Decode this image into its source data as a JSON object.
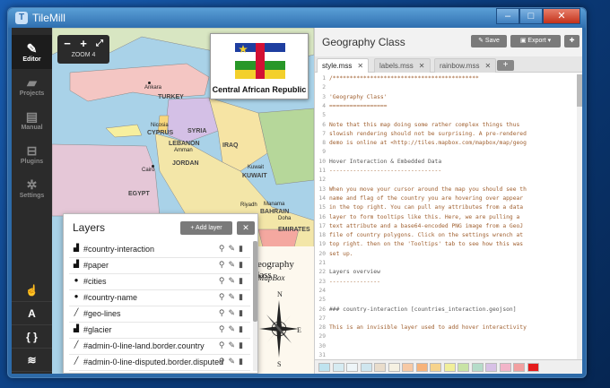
{
  "window": {
    "title": "TileMill"
  },
  "nav": {
    "items": [
      {
        "label": "Editor",
        "icon": "pencil-icon"
      },
      {
        "label": "Projects",
        "icon": "folder-icon"
      },
      {
        "label": "Manual",
        "icon": "book-icon"
      },
      {
        "label": "Plugins",
        "icon": "plug-icon"
      },
      {
        "label": "Settings",
        "icon": "gear-icon"
      }
    ]
  },
  "map": {
    "zoom_label": "ZOOM 4",
    "tooltip_country": "Central African Republic",
    "legend_title": "Geography Class",
    "legend_subtitle": "MapBox",
    "labels": {
      "ankara": "Ankara",
      "turkey": "TURKEY",
      "nicosia": "Nicosia",
      "syria": "SYRIA",
      "cyprus": "CYPRUS",
      "lebanon": "LEBANON",
      "iraq": "IRAQ",
      "amman": "Amman",
      "jordan": "JORDAN",
      "cairo": "Cairo",
      "kuwait_city": "Kuwait",
      "kuwait": "KUWAIT",
      "egypt": "EGYPT",
      "manama": "Manama",
      "bahrain": "BAHRAIN",
      "riyadh": "Riyadh",
      "doha": "Doha",
      "emirates": "EMIRATES"
    }
  },
  "layers": {
    "title": "Layers",
    "add_label": "+ Add layer",
    "items": [
      {
        "name": "#country-interaction",
        "icon": "▟"
      },
      {
        "name": "#paper",
        "icon": "▟"
      },
      {
        "name": "#cities",
        "icon": "●"
      },
      {
        "name": "#country-name",
        "icon": "●"
      },
      {
        "name": "#geo-lines",
        "icon": "╱"
      },
      {
        "name": "#glacier",
        "icon": "▟"
      },
      {
        "name": "#admin-0-line-land.border.country",
        "icon": "╱"
      },
      {
        "name": "#admin-0-line-disputed.border.disputed",
        "icon": "╱"
      }
    ]
  },
  "editor": {
    "title": "Geography Class",
    "save_label": "Save",
    "export_label": "Export",
    "tabs": [
      "style.mss",
      "labels.mss",
      "rainbow.mss"
    ],
    "code_lines": [
      "/*******************************************",
      "",
      "'Geography Class'",
      "=================",
      "",
      "Note that this map doing some rather complex things thus",
      "slowish rendering should not be surprising. A pre-rendered",
      "demo is online at <http://tiles.mapbox.com/mapbox/map/geog",
      "",
      "Hover Interaction & Embedded Data",
      "---------------------------------",
      "",
      "When you move your cursor around the map you should see th",
      "name and flag of the country you are hovering over appear",
      "in the top right. You can pull any attributes from a data",
      "layer to form tooltips like this. Here, we are pulling a",
      "text attribute and a base64-encoded PNG image from a GeoJ",
      "file of country polygons. Click on the settings wrench at",
      "top right. then on the 'Tooltips' tab to see how this was",
      "set up.",
      "",
      "Layers overview",
      "---------------",
      "",
      "",
      "### country-interaction [countries_interaction.geojson]",
      "",
      "This is an invisible layer used to add hover interactivity",
      "",
      "",
      ""
    ],
    "swatches": [
      "#bfe3ef",
      "#d6ebf2",
      "#eef5f8",
      "#cfe6ef",
      "#e9dccb",
      "#f6f1e2",
      "#f7c9a5",
      "#f7b37a",
      "#f6d38c",
      "#f1ef9a",
      "#c8e3a5",
      "#b5dcc9",
      "#d8c1e6",
      "#f2b5c9",
      "#f2a0a0",
      "#e41b1b"
    ]
  }
}
